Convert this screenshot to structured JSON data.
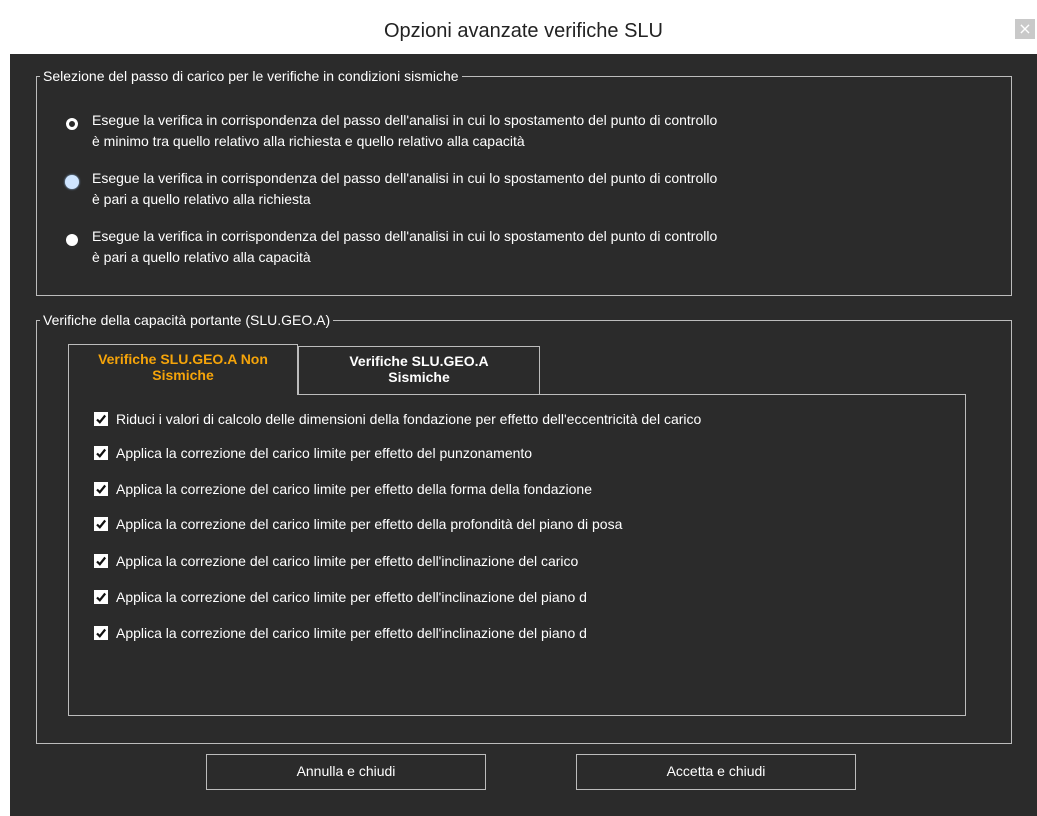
{
  "window": {
    "title": "Opzioni avanzate verifiche SLU",
    "close_glyph": "×"
  },
  "seismic_group": {
    "legend": "Selezione del passo di carico per le verifiche in condizioni sismiche",
    "options": [
      {
        "line1": "Esegue la verifica in corrispondenza del passo dell'analisi in cui lo spostamento del punto di controllo",
        "line2": "è minimo tra quello relativo alla richiesta e quello relativo alla capacità",
        "selected": true
      },
      {
        "line1": "Esegue la verifica in corrispondenza del passo dell'analisi in cui lo spostamento del punto di controllo",
        "line2": "è pari a quello relativo alla richiesta",
        "selected": false
      },
      {
        "line1": "Esegue la verifica in corrispondenza del passo dell'analisi in cui lo spostamento del punto di controllo",
        "line2": "è pari a quello relativo alla capacità",
        "selected": false
      }
    ]
  },
  "bearing_group": {
    "legend": "Verifiche della capacità portante (SLU.GEO.A)",
    "tabs": [
      {
        "line1": "Verifiche SLU.GEO.A Non",
        "line2": "Sismiche",
        "active": true
      },
      {
        "line1": "Verifiche SLU.GEO.A",
        "line2": "Sismiche",
        "active": false
      }
    ],
    "checks": [
      {
        "label": "Riduci i valori di calcolo delle dimensioni della fondazione per effetto dell'eccentricità del carico",
        "checked": true
      },
      {
        "label": "Applica la correzione del carico limite per effetto del punzonamento",
        "checked": true
      },
      {
        "label": "Applica la correzione del carico limite per effetto della forma della fondazione",
        "checked": true
      },
      {
        "label": "Applica la correzione del carico limite per effetto della profondità del piano di posa",
        "checked": true
      },
      {
        "label": "Applica la correzione del carico limite per effetto dell'inclinazione del carico",
        "checked": true
      },
      {
        "label": "Applica la correzione del carico limite per effetto dell'inclinazione del piano d",
        "checked": true
      },
      {
        "label": "Applica la correzione del carico limite per effetto dell'inclinazione del piano d",
        "checked": true
      }
    ]
  },
  "buttons": {
    "cancel": "Annulla e chiudi",
    "accept": "Accetta e chiudi"
  },
  "colors": {
    "background": "#2b2b2b",
    "active_tab_text": "#f5a40a",
    "border": "#bcbcbc"
  }
}
